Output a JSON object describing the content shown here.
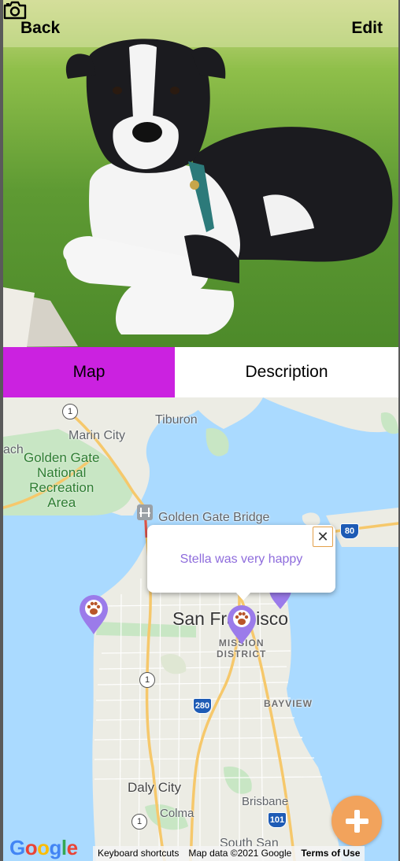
{
  "header": {
    "back_label": "Back",
    "edit_label": "Edit"
  },
  "tabs": [
    {
      "label": "Map"
    },
    {
      "label": "Description"
    }
  ],
  "colors": {
    "tab_active": "#cb22e0",
    "pin": "#9b7bea",
    "fab": "#f2a35c",
    "popup_text": "#8e6cdc"
  },
  "map": {
    "labels": {
      "marin_city": "Marin City",
      "tiburon": "Tiburon",
      "golden_gate_park_area": "Golden Gate\nNational\nRecreation\nArea",
      "ach": "ach",
      "golden_gate_bridge": "Golden Gate Bridge",
      "san_francisco": "San Francisco",
      "mission_district": "MISSION\nDISTRICT",
      "bayview": "BAYVIEW",
      "daly_city": "Daly City",
      "brisbane": "Brisbane",
      "colma": "Colma",
      "south_san": "South San"
    },
    "highway_shields": [
      "1",
      "1",
      "1",
      "280",
      "101",
      "80"
    ],
    "popup": {
      "text": "Stella was very happy",
      "close": "✕"
    },
    "attribution": {
      "google": "Google",
      "keyboard": "Keyboard shortcuts",
      "map_data": "Map data ©2021 Google",
      "terms": "Terms of Use"
    }
  }
}
